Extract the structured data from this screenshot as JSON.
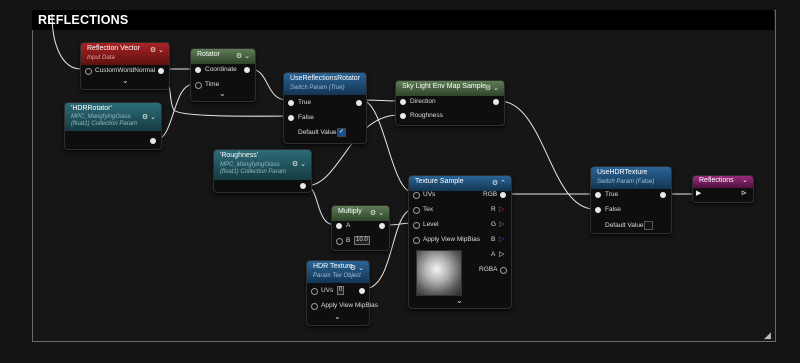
{
  "comment": {
    "title": "REFLECTIONS"
  },
  "nodes": {
    "reflection_vector": {
      "title": "Reflection Vector",
      "subtitle": "Input Data",
      "pins": {
        "custom_world_normal": "CustomWorldNormal"
      },
      "color": "#8f1c1c"
    },
    "rotator": {
      "title": "Rotator",
      "pins": {
        "coordinate": "Coordinate",
        "time": "Time"
      },
      "color": "#4d6b45"
    },
    "hdr_rotator": {
      "title": "'HDRRotator'",
      "subtitle1": "MPC_MangfyingGlass",
      "subtitle2": "(float1) Collection Param",
      "color": "#22515b"
    },
    "use_reflections_rotator": {
      "title": "UseReflectionsRotator",
      "subtitle": "Switch Param (True)",
      "pins": {
        "true": "True",
        "false": "False",
        "default_value": "Default Value"
      },
      "default_checked": true,
      "color": "#1f4f78"
    },
    "sky_light": {
      "title": "Sky Light Env Map Sample",
      "pins": {
        "direction": "Direction",
        "roughness": "Roughness"
      },
      "color": "#4d6b45"
    },
    "roughness": {
      "title": "'Roughness'",
      "subtitle1": "MPC_MangfyingGlass",
      "subtitle2": "(float1) Collection Param",
      "color": "#22515b"
    },
    "multiply": {
      "title": "Multiply",
      "pins": {
        "a": "A",
        "b": "B"
      },
      "b_value": "10.0",
      "color": "#4d6b45"
    },
    "texture_sample": {
      "title": "Texture Sample",
      "pins": {
        "uvs": "UVs",
        "tex": "Tex",
        "level": "Level",
        "apply_mip": "Apply View MipBias",
        "rgb": "RGB",
        "r": "R",
        "g": "G",
        "b": "B",
        "a": "A",
        "rgba": "RGBA"
      },
      "color": "#1f4f78"
    },
    "hdr_texture": {
      "title": "HDR Texture",
      "subtitle": "Param Tex Object",
      "pins": {
        "uvs": "UVs",
        "apply_mip": "Apply View MipBias"
      },
      "uvs_value": "0",
      "color": "#1f4f78"
    },
    "use_hdr_texture": {
      "title": "UseHDRTexture",
      "subtitle": "Switch Param (False)",
      "pins": {
        "true": "True",
        "false": "False",
        "default_value": "Default Value"
      },
      "default_checked": false,
      "color": "#1f4f78"
    },
    "reflections": {
      "title": "Reflections",
      "color": "#7a1f60"
    }
  },
  "pin_colors": {
    "r": "#e03030",
    "g": "#30c030",
    "b": "#3050e0",
    "exec": "#e9e9e9"
  },
  "icons": {
    "settings": "gear-icon",
    "collapse": "chevron-down-icon",
    "expand": "chevron-up-icon",
    "resize": "resize-grip-icon"
  }
}
